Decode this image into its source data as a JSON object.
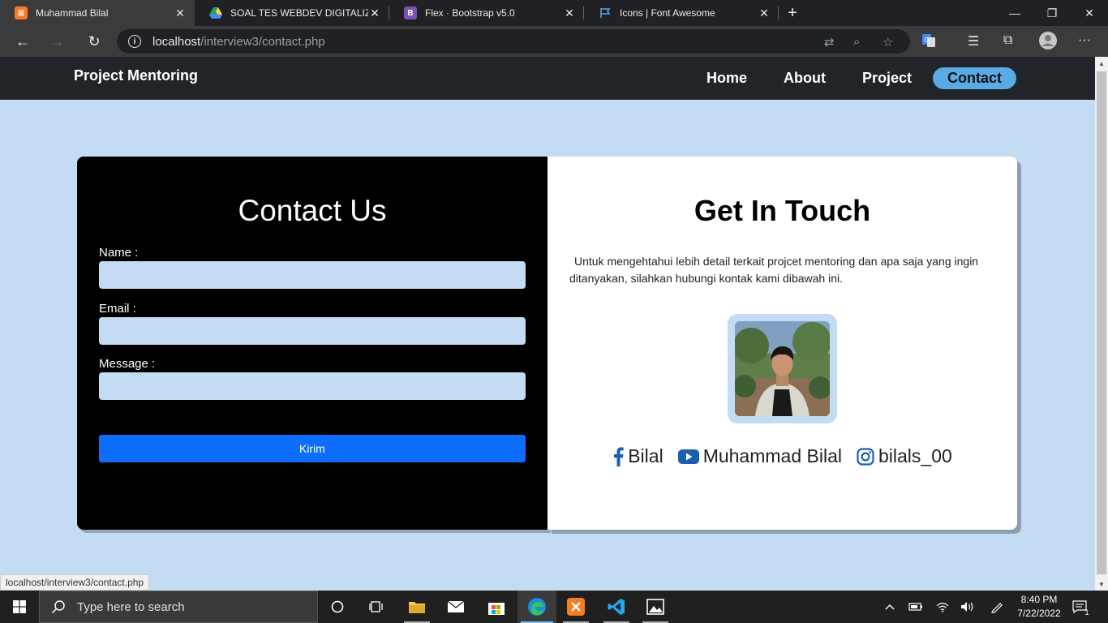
{
  "browser": {
    "tabs": [
      {
        "title": "Muhammad Bilal",
        "icon": "xampp-icon",
        "color": "#fb7a24"
      },
      {
        "title": "SOAL TES WEBDEV DIGITALIZ BA",
        "icon": "google-drive-icon",
        "color": "#1fa463"
      },
      {
        "title": "Flex · Bootstrap v5.0",
        "icon": "bootstrap-icon",
        "color": "#7952b3"
      },
      {
        "title": "Icons | Font Awesome",
        "icon": "font-awesome-flag-icon",
        "color": "#5aa0e6"
      }
    ],
    "url_host": "localhost",
    "url_path": "/interview3/contact.php",
    "status_url": "localhost/interview3/contact.php"
  },
  "site": {
    "brand": "Project Mentoring",
    "nav": [
      "Home",
      "About",
      "Project",
      "Contact"
    ],
    "active_nav": "Contact"
  },
  "contact_form": {
    "title": "Contact Us",
    "name_label": "Name :",
    "email_label": "Email :",
    "message_label": "Message :",
    "name_value": "",
    "email_value": "",
    "message_value": "",
    "submit_label": "Kirim"
  },
  "get_in_touch": {
    "title": "Get In Touch",
    "description": "Untuk mengehtahui lebih detail terkait projcet mentoring dan apa saja yang ingin ditanyakan, silahkan hubungi kontak kami dibawah ini.",
    "socials": [
      {
        "icon": "facebook-icon",
        "label": "Bilal"
      },
      {
        "icon": "youtube-icon",
        "label": "Muhammad Bilal"
      },
      {
        "icon": "instagram-icon",
        "label": "bilals_00"
      }
    ]
  },
  "taskbar": {
    "search_placeholder": "Type here to search",
    "time": "8:40 PM",
    "date": "7/22/2022",
    "notification_count": "1"
  },
  "colors": {
    "page_bg": "#c4dcf3",
    "navbar_bg": "#212529",
    "nav_active_bg": "#5aaae6",
    "submit_bg": "#0d6efd",
    "social_icon": "#1c5fb0"
  }
}
